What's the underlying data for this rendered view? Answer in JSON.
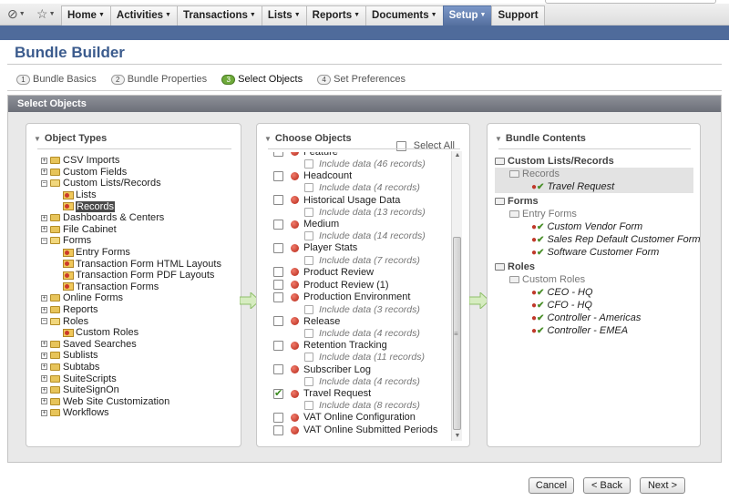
{
  "nav": {
    "menu": [
      {
        "label": "Home",
        "active": false
      },
      {
        "label": "Activities",
        "active": false
      },
      {
        "label": "Transactions",
        "active": false
      },
      {
        "label": "Lists",
        "active": false
      },
      {
        "label": "Reports",
        "active": false
      },
      {
        "label": "Documents",
        "active": false
      },
      {
        "label": "Setup",
        "active": true
      },
      {
        "label": "Support",
        "active": false
      }
    ],
    "icons": [
      "clock-icon",
      "star-icon"
    ]
  },
  "page": {
    "title": "Bundle Builder"
  },
  "steps": [
    {
      "num": "1",
      "label": "Bundle Basics"
    },
    {
      "num": "2",
      "label": "Bundle Properties"
    },
    {
      "num": "3",
      "label": "Select Objects"
    },
    {
      "num": "4",
      "label": "Set Preferences"
    }
  ],
  "current_step": "Select Objects",
  "panel": {
    "title": "Select Objects"
  },
  "object_types": {
    "title": "Object Types",
    "selected": "Records",
    "items": [
      {
        "label": "CSV Imports",
        "level": 0,
        "expanded": false
      },
      {
        "label": "Custom Fields",
        "level": 0,
        "expanded": false
      },
      {
        "label": "Custom Lists/Records",
        "level": 0,
        "expanded": true
      },
      {
        "label": "Lists",
        "level": 1
      },
      {
        "label": "Records",
        "level": 1
      },
      {
        "label": "Dashboards & Centers",
        "level": 0,
        "expanded": false
      },
      {
        "label": "File Cabinet",
        "level": 0,
        "expanded": false
      },
      {
        "label": "Forms",
        "level": 0,
        "expanded": true
      },
      {
        "label": "Entry Forms",
        "level": 1
      },
      {
        "label": "Transaction Form HTML Layouts",
        "level": 1
      },
      {
        "label": "Transaction Form PDF Layouts",
        "level": 1
      },
      {
        "label": "Transaction Forms",
        "level": 1
      },
      {
        "label": "Online Forms",
        "level": 0,
        "expanded": false
      },
      {
        "label": "Reports",
        "level": 0,
        "expanded": false
      },
      {
        "label": "Roles",
        "level": 0,
        "expanded": true
      },
      {
        "label": "Custom Roles",
        "level": 1
      },
      {
        "label": "Saved Searches",
        "level": 0,
        "expanded": false
      },
      {
        "label": "Sublists",
        "level": 0,
        "expanded": false
      },
      {
        "label": "Subtabs",
        "level": 0,
        "expanded": false
      },
      {
        "label": "SuiteScripts",
        "level": 0,
        "expanded": false
      },
      {
        "label": "SuiteSignOn",
        "level": 0,
        "expanded": false
      },
      {
        "label": "Web Site Customization",
        "level": 0,
        "expanded": false
      },
      {
        "label": "Workflows",
        "level": 0,
        "expanded": false
      }
    ]
  },
  "choose_objects": {
    "title": "Choose Objects",
    "select_all_label": "Select All",
    "items": [
      {
        "label": "Feature",
        "checked": false,
        "sub": "Include data (46 records)"
      },
      {
        "label": "Headcount",
        "checked": false,
        "sub": "Include data (4 records)"
      },
      {
        "label": "Historical Usage Data",
        "checked": false,
        "sub": "Include data (13 records)"
      },
      {
        "label": "Medium",
        "checked": false,
        "sub": "Include data (14 records)"
      },
      {
        "label": "Player Stats",
        "checked": false,
        "sub": "Include data (7 records)"
      },
      {
        "label": "Product Review",
        "checked": false,
        "sub": ""
      },
      {
        "label": "Product Review (1)",
        "checked": false,
        "sub": ""
      },
      {
        "label": "Production Environment",
        "checked": false,
        "sub": "Include data (3 records)"
      },
      {
        "label": "Release",
        "checked": false,
        "sub": "Include data (4 records)"
      },
      {
        "label": "Retention Tracking",
        "checked": false,
        "sub": "Include data (11 records)"
      },
      {
        "label": "Subscriber Log",
        "checked": false,
        "sub": "Include data (4 records)"
      },
      {
        "label": "Travel Request",
        "checked": true,
        "sub": "Include data (8 records)"
      },
      {
        "label": "VAT Online Configuration",
        "checked": false,
        "sub": ""
      },
      {
        "label": "VAT Online Submitted Periods",
        "checked": false,
        "sub": ""
      }
    ]
  },
  "bundle_contents": {
    "title": "Bundle Contents",
    "groups": [
      {
        "label": "Custom Lists/Records",
        "subs": [
          {
            "label": "Records",
            "highlight": true,
            "items": [
              "Travel Request"
            ]
          }
        ]
      },
      {
        "label": "Forms",
        "subs": [
          {
            "label": "Entry Forms",
            "highlight": false,
            "items": [
              "Custom Vendor Form",
              "Sales Rep Default Customer Form",
              "Software Customer Form"
            ]
          }
        ]
      },
      {
        "label": "Roles",
        "subs": [
          {
            "label": "Custom Roles",
            "highlight": false,
            "items": [
              "CEO - HQ",
              "CFO - HQ",
              "Controller - Americas",
              "Controller - EMEA"
            ]
          }
        ]
      }
    ]
  },
  "footer": {
    "cancel_label": "Cancel",
    "back_label": "< Back",
    "next_label": "Next >"
  },
  "colors": {
    "nav_active": "#55709f",
    "bluebar": "#4f6b9b",
    "title": "#3b5b8d",
    "panel_header": "#7a7d86",
    "step_current": "#6eaa3a"
  }
}
